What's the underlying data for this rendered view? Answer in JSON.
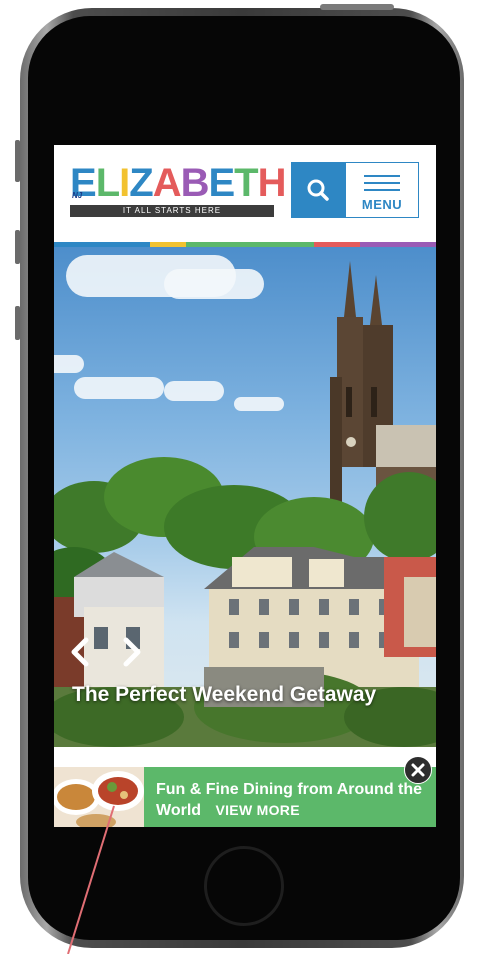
{
  "header": {
    "logo_text": "ELIZABETH",
    "logo_nj": "NJ",
    "logo_tagline": "IT ALL STARTS HERE",
    "menu_label": "MENU"
  },
  "hero": {
    "title": "The Perfect Weekend Getaway"
  },
  "promo": {
    "text": "Fun & Fine Dining from Around the World",
    "cta": "VIEW MORE"
  },
  "colors": {
    "accent_blue": "#2e87c4",
    "promo_green": "#5cb86a",
    "stripe": [
      "#2e87c4",
      "#f2c230",
      "#5cb86a",
      "#e45b5b",
      "#9a5bb5"
    ]
  },
  "icons": [
    "search-icon",
    "menu-icon",
    "chevron-left-icon",
    "chevron-right-icon",
    "close-icon"
  ]
}
